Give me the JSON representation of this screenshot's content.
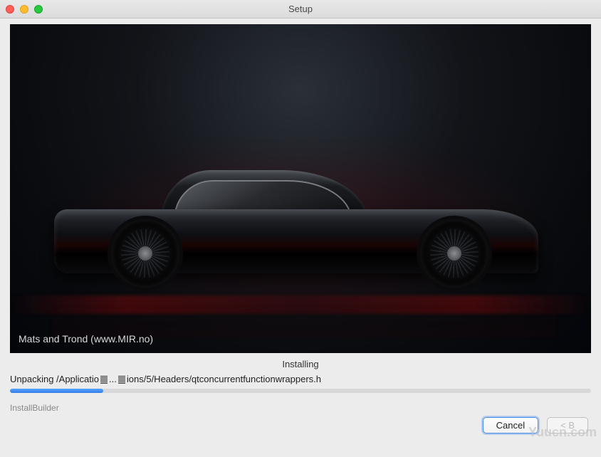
{
  "window": {
    "title": "Setup"
  },
  "hero": {
    "credit": "Mats and Trond (www.MIR.no)"
  },
  "install": {
    "status": "Installing",
    "unpack_prefix": "Unpacking /Applicatio",
    "unpack_mid": "...",
    "unpack_suffix": "ions/5/Headers/qtconcurrentfunctionwrappers.h",
    "progress_percent": 16
  },
  "footer": {
    "builder": "InstallBuilder"
  },
  "buttons": {
    "cancel": "Cancel",
    "back": "< B"
  },
  "watermark": "Yuucn.com"
}
